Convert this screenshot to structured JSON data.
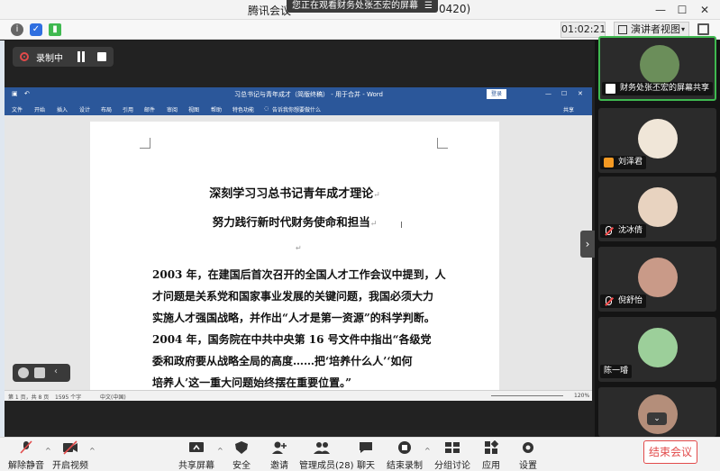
{
  "window": {
    "title": "腾讯会议",
    "meeting_id_fragment": "0420)",
    "share_banner": "您正在观看财务处张丕宏的屏幕"
  },
  "infobar": {
    "timer": "01:02:21",
    "view_mode": "演讲者视图"
  },
  "recording": {
    "label": "录制中"
  },
  "word": {
    "title": "习总书记与青年成才（简版终稿） - 用于合并 - Word",
    "login_label": "登录",
    "share_label": "共享",
    "tell_me": "告诉我你想要做什么",
    "ribbon_tabs": [
      "文件",
      "开始",
      "插入",
      "设计",
      "布局",
      "引用",
      "邮件",
      "审阅",
      "视图",
      "帮助",
      "特色功能"
    ],
    "status": {
      "page": "第 1 页，共 8 页",
      "words": "1595 个字",
      "language": "中文(中国)",
      "zoom": "120%"
    },
    "document": {
      "title": "深刻学习习总书记青年成才理论",
      "subtitle": "努力践行新时代财务使命和担当",
      "lines": [
        "2003 年，在建国后首次召开的全国人才工作会议中提到，人",
        "才问题是关系党和国家事业发展的关键问题，我国必须大力",
        "实施人才强国战略，并作出“人才是第一资源”的科学判断。",
        "2004  年，国务院在中共中央第  16  号文件中指出“各级党",
        "委和政府要从战略全局的高度……把‘培养什么人’‘如何",
        "培养人’这一重大问题始终摆在重要位置。”"
      ]
    }
  },
  "participants": [
    {
      "name": "财务处张丕宏的屏幕共享",
      "icon": "screen-share-icon",
      "avatar_color": "#6b8e5a",
      "active": true
    },
    {
      "name": "刘泽君",
      "icon": "user-icon",
      "avatar_color": "#f0e6d8",
      "active": false
    },
    {
      "name": "沈冰倩",
      "icon": "mic-muted-icon",
      "avatar_color": "#e8d3c0",
      "active": false
    },
    {
      "name": "倪舒怡",
      "icon": "mic-muted-icon",
      "avatar_color": "#c99a88",
      "active": false
    },
    {
      "name": "陈一璿",
      "icon": "",
      "avatar_color": "#9ccf9a",
      "active": false
    }
  ],
  "toolbar": {
    "unmute": "解除静音",
    "start_video": "开启视频",
    "share_screen": "共享屏幕",
    "security": "安全",
    "invite": "邀请",
    "manage_members": "管理成员(28)",
    "chat": "聊天",
    "end_recording": "结束录制",
    "breakout": "分组讨论",
    "apps": "应用",
    "settings": "设置",
    "end_meeting": "结束会议"
  }
}
